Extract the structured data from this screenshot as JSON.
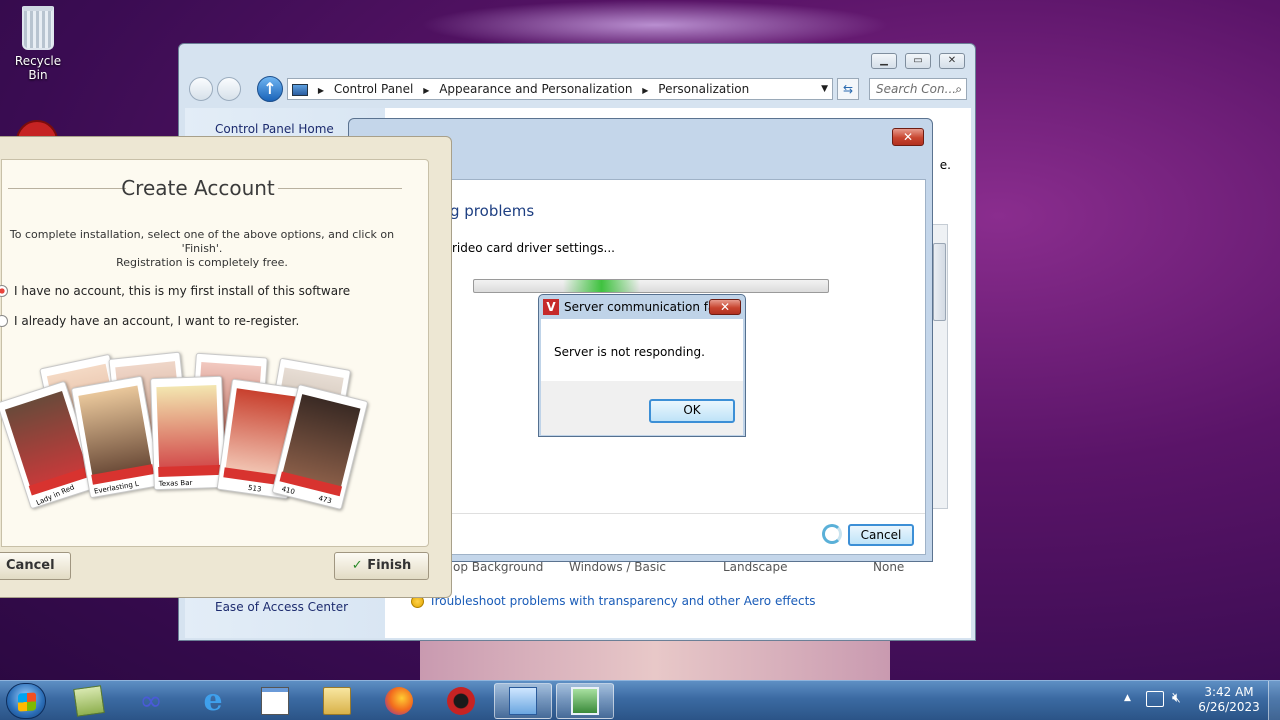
{
  "desktop": {
    "recycle_bin_label": "Recycle Bin"
  },
  "explorer": {
    "breadcrumb": [
      "Control Panel",
      "Appearance and Personalization",
      "Personalization"
    ],
    "search_placeholder": "Search Con...",
    "sidebar": {
      "home": "Control Panel Home",
      "ease_of_access": "Ease of Access Center"
    },
    "partial_text_right": "e.",
    "bottom_labels": [
      "op Background",
      "Windows / Basic",
      "Landscape",
      "None"
    ],
    "troubleshoot_link": "Troubleshoot problems with transparency and other Aero effects"
  },
  "appearance_dialog": {
    "heading": "g problems",
    "status": "rideo card driver settings...",
    "progress_fraction": 0.35,
    "cancel_label": "Cancel"
  },
  "error_dialog": {
    "title": "Server communication fa...",
    "message": "Server is not responding.",
    "ok_label": "OK"
  },
  "create_account": {
    "title": "Create Account",
    "instructions_line1": "To complete installation, select one of the above options, and click on 'Finish'.",
    "instructions_line2": "Registration is completely free.",
    "option_new": "I have no account, this is my first install of this software",
    "option_existing": "I already have an account, I want to re-register.",
    "cancel_label": "Cancel",
    "finish_label": "Finish",
    "card_captions": [
      "Lady in Red",
      "Everlasting L",
      "Texas Bar",
      "513",
      "410",
      "473"
    ]
  },
  "taskbar": {
    "time": "3:42 AM",
    "date": "6/26/2023",
    "items": [
      "start",
      "app",
      "infinity",
      "internet-explorer",
      "notepad",
      "file-explorer",
      "firefox",
      "app-red",
      "control-panel",
      "display-settings"
    ]
  }
}
